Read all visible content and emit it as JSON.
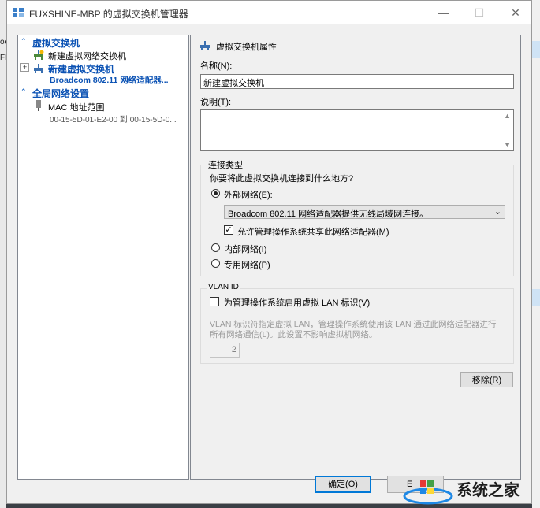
{
  "window": {
    "title": "FUXSHINE-MBP 的虚拟交换机管理器",
    "minimize": "—",
    "maximize": "☐",
    "close": "✕"
  },
  "background": {
    "left_fragments": [
      "oe",
      "Fl"
    ]
  },
  "tree": {
    "section_switches": "虚拟交换机",
    "new_switch": "新建虚拟网络交换机",
    "switch_name": "新建虚拟交换机",
    "switch_adapter": "Broadcom 802.11 网络适配器...",
    "section_global": "全局网络设置",
    "mac_range": "MAC 地址范围",
    "mac_value": "00-15-5D-01-E2-00 到 00-15-5D-0..."
  },
  "properties": {
    "header": "虚拟交换机属性",
    "name_label": "名称(N):",
    "name_value": "新建虚拟交换机",
    "notes_label": "说明(T):",
    "notes_value": "",
    "conn_type_label": "连接类型",
    "conn_question": "你要将此虚拟交换机连接到什么地方?",
    "external": "外部网络(E):",
    "adapter_selected": "Broadcom 802.11 网络适配器提供无线局域网连接。",
    "allow_share": "允许管理操作系统共享此网络适配器(M)",
    "internal": "内部网络(I)",
    "private": "专用网络(P)",
    "vlan_label": "VLAN ID",
    "vlan_enable": "为管理操作系统启用虚拟 LAN 标识(V)",
    "vlan_desc1": "VLAN 标识符指定虚拟 LAN，管理操作系统使用该 LAN 通过此网络适配器进行",
    "vlan_desc2": "所有网络通信(L)。此设置不影响虚拟机网络。",
    "vlan_value": "2",
    "remove": "移除(R)"
  },
  "footer": {
    "ok": "确定(O)",
    "cancel_partial": "E"
  },
  "watermark": {
    "text": "系统之家"
  },
  "colors": {
    "accent": "#0078d7",
    "tree_header": "#0b52b4",
    "selected_item": "#0b52b4"
  }
}
